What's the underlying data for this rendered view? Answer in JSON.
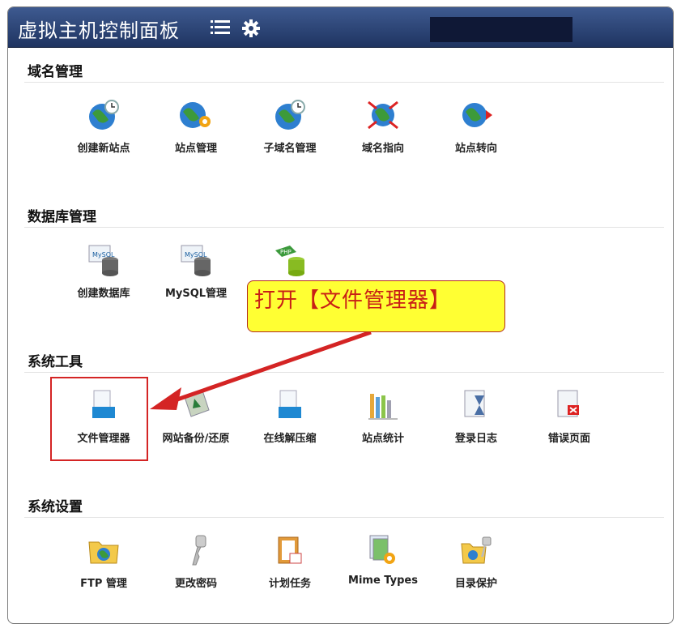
{
  "header": {
    "title": "虚拟主机控制面板"
  },
  "sections": [
    {
      "title": "域名管理",
      "items": [
        {
          "label": "创建新站点",
          "icon": "globe-clock-icon"
        },
        {
          "label": "站点管理",
          "icon": "globe-gear-icon"
        },
        {
          "label": "子域名管理",
          "icon": "globe-clock-icon"
        },
        {
          "label": "域名指向",
          "icon": "globe-arrows-icon"
        },
        {
          "label": "站点转向",
          "icon": "globe-forward-icon"
        }
      ]
    },
    {
      "title": "数据库管理",
      "items": [
        {
          "label": "创建数据库",
          "icon": "mysql-database-icon"
        },
        {
          "label": "MySQL管理",
          "icon": "mysql-database-icon"
        },
        {
          "label": "",
          "icon": "php-database-icon"
        }
      ]
    },
    {
      "title": "系统工具",
      "items": [
        {
          "label": "文件管理器",
          "icon": "file-manager-icon"
        },
        {
          "label": "网站备份/还原",
          "icon": "backup-icon"
        },
        {
          "label": "在线解压缩",
          "icon": "unzip-icon"
        },
        {
          "label": "站点统计",
          "icon": "bar-chart-icon"
        },
        {
          "label": "登录日志",
          "icon": "hourglass-log-icon"
        },
        {
          "label": "错误页面",
          "icon": "error-page-icon"
        }
      ]
    },
    {
      "title": "系统设置",
      "items": [
        {
          "label": "FTP 管理",
          "icon": "ftp-folder-icon"
        },
        {
          "label": "更改密码",
          "icon": "key-icon"
        },
        {
          "label": "计划任务",
          "icon": "clipboard-calendar-icon"
        },
        {
          "label": "Mime Types",
          "icon": "document-gear-icon"
        },
        {
          "label": "目录保护",
          "icon": "folder-key-icon"
        }
      ]
    }
  ],
  "annotation": {
    "text": "打开【文件管理器】"
  },
  "colors": {
    "header": "#2b4170",
    "callout_bg": "#ffff33",
    "callout_text": "#c81e16",
    "highlight": "#d42424"
  }
}
